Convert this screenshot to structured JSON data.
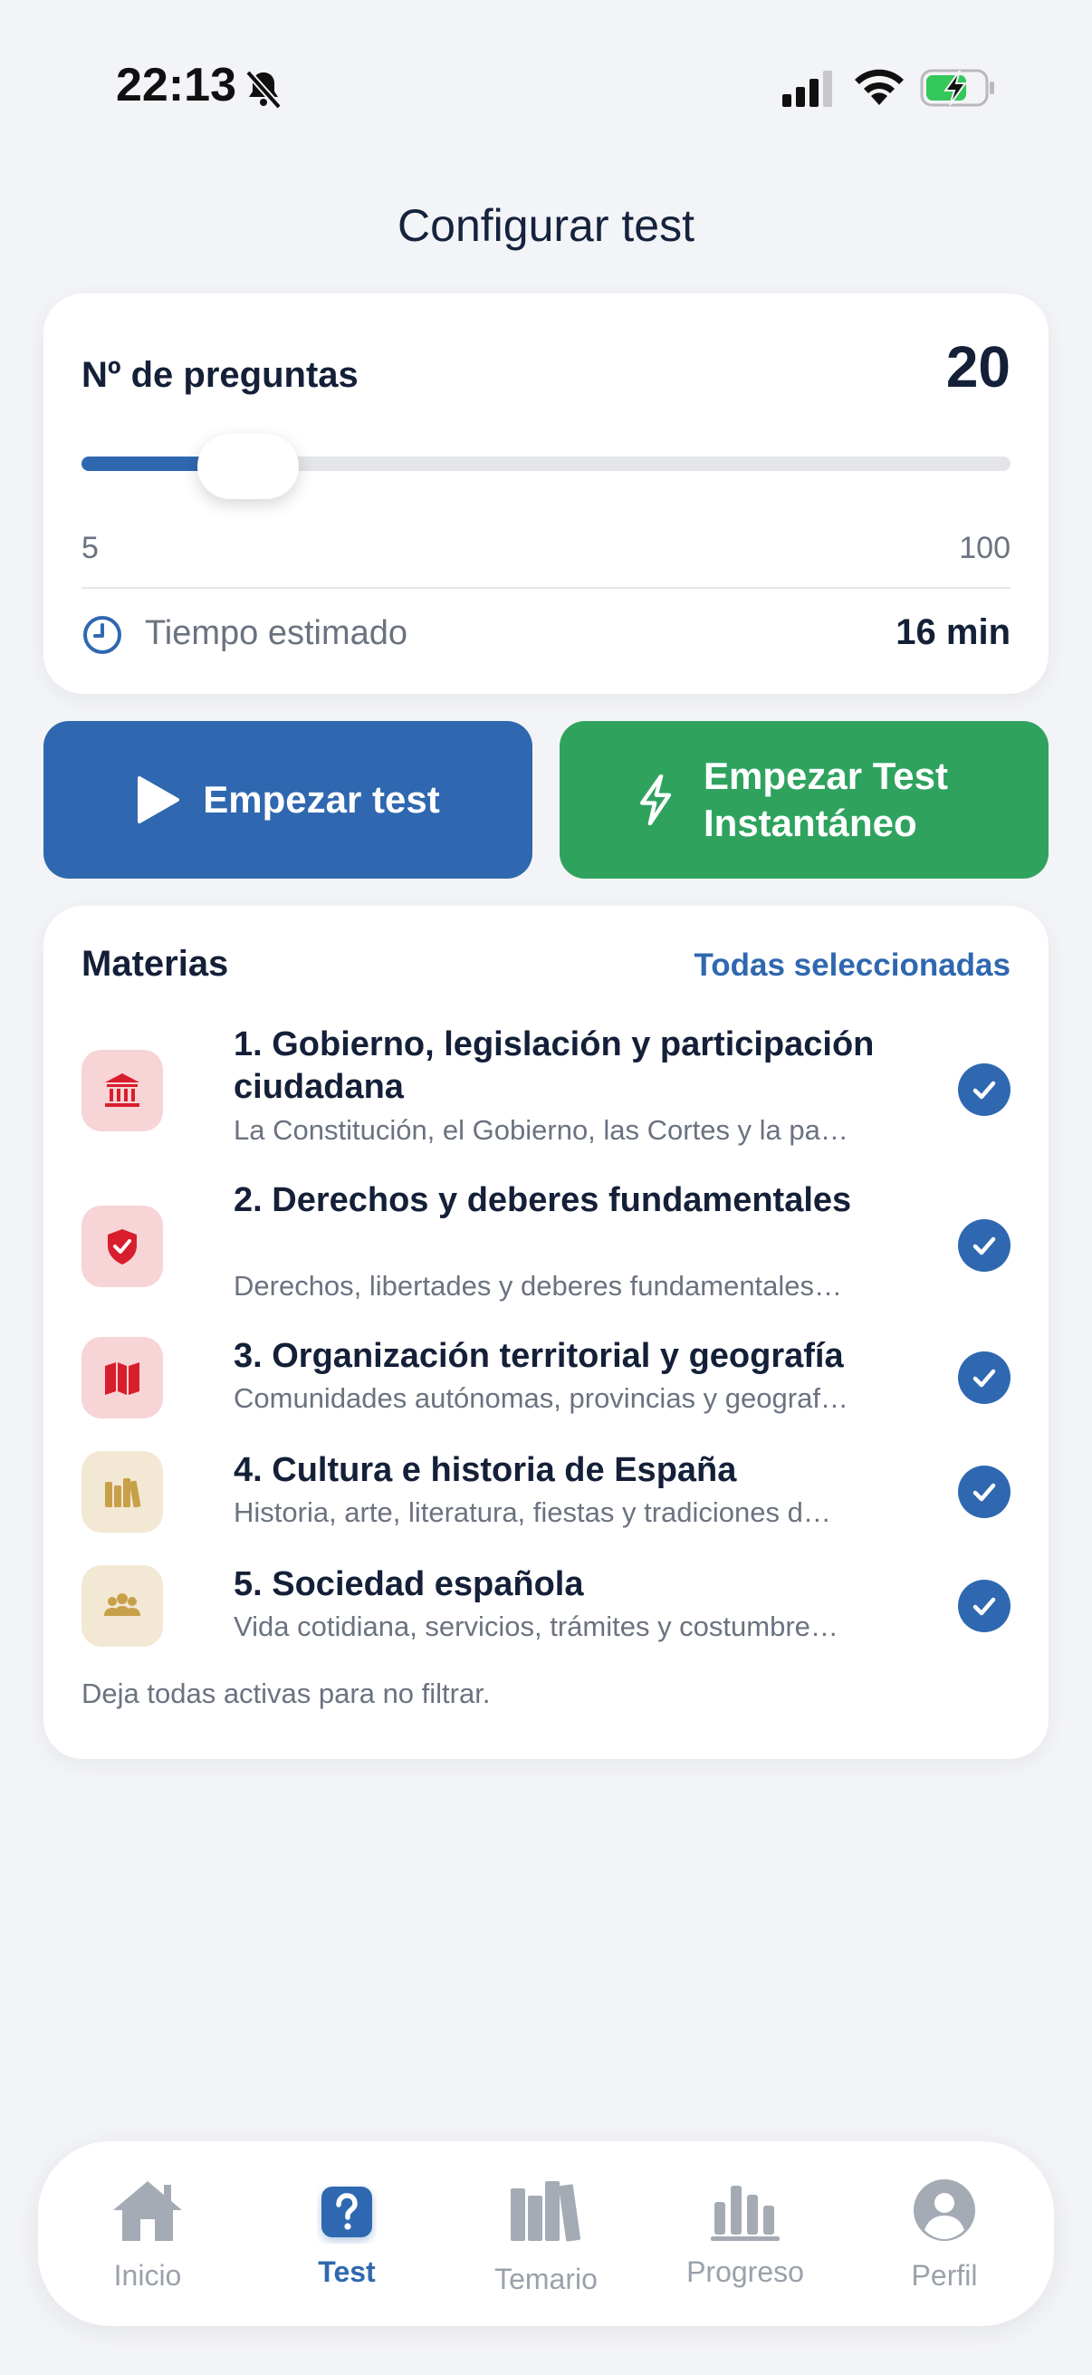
{
  "status_bar": {
    "time": "22:13"
  },
  "page": {
    "title": "Configurar test"
  },
  "questions": {
    "label": "Nº de preguntas",
    "value": "20",
    "slider_min": "5",
    "slider_max": "100",
    "slider_fraction": 0.158,
    "time_label": "Tiempo estimado",
    "time_value": "16 min"
  },
  "buttons": {
    "start": "Empezar test",
    "instant": "Empezar Test Instantáneo"
  },
  "topics": {
    "title": "Materias",
    "all_selected": "Todas seleccionadas",
    "items": [
      {
        "name": "1. Gobierno, legislación y participación ciudadana",
        "desc": "La Constitución, el Gobierno, las Cortes y la pa…",
        "icon": "bank-icon",
        "checked": true
      },
      {
        "name": "2. Derechos y deberes fundamentales",
        "desc": "Derechos, libertades y deberes fundamentales…",
        "icon": "shield-icon",
        "checked": true
      },
      {
        "name": "3. Organización territorial y geografía",
        "desc": "Comunidades autónomas, provincias y geograf…",
        "icon": "map-icon",
        "checked": true
      },
      {
        "name": "4. Cultura e historia de España",
        "desc": "Historia, arte, literatura, fiestas y tradiciones d…",
        "icon": "books-icon",
        "checked": true
      },
      {
        "name": "5. Sociedad española",
        "desc": "Vida cotidiana, servicios, trámites y costumbre…",
        "icon": "people-icon",
        "checked": true
      }
    ],
    "hint": "Deja todas activas para no filtrar."
  },
  "tabs": [
    {
      "label": "Inicio",
      "icon": "home-icon"
    },
    {
      "label": "Test",
      "icon": "question-icon",
      "active": true
    },
    {
      "label": "Temario",
      "icon": "books-icon"
    },
    {
      "label": "Progreso",
      "icon": "bar-chart-icon"
    },
    {
      "label": "Perfil",
      "icon": "person-icon"
    }
  ],
  "colors": {
    "accent": "#2f68b0",
    "green": "#2fa35e",
    "topic_red": "#d81e2c",
    "topic_gold": "#c9a04a"
  }
}
